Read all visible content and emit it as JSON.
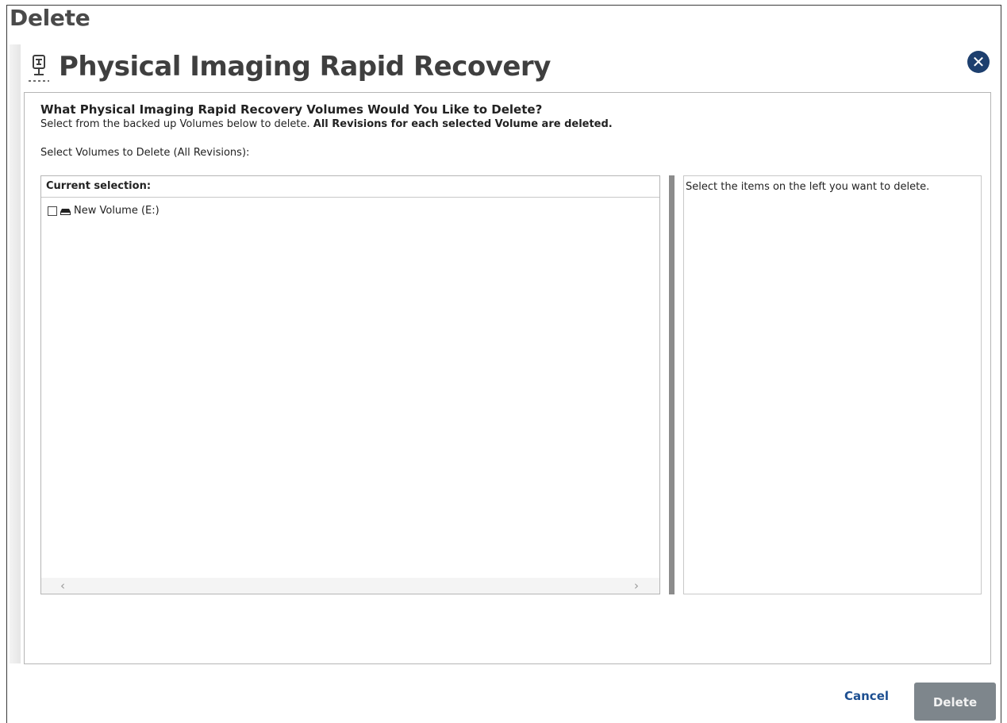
{
  "page": {
    "title": "Delete"
  },
  "dialog": {
    "title": "Physical Imaging Rapid Recovery",
    "icon": "physical-imaging-icon",
    "close_icon": "close-icon",
    "question": "What Physical Imaging Rapid Recovery Volumes Would You Like to Delete?",
    "instruction_plain": "Select from the backed up Volumes below to delete. ",
    "instruction_bold": "All Revisions for each selected Volume are deleted.",
    "select_label": "Select Volumes to Delete (All Revisions):"
  },
  "tree": {
    "header": "Current selection:",
    "items": [
      {
        "label": "New Volume (E:)",
        "checked": false,
        "icon": "drive-icon"
      }
    ],
    "scroll_left_glyph": "‹",
    "scroll_right_glyph": "›"
  },
  "details": {
    "text": "Select the items on the left you want to delete."
  },
  "footer": {
    "cancel_label": "Cancel",
    "delete_label": "Delete"
  },
  "colors": {
    "title_text": "#3f3f3f",
    "close_button": "#1d3f6e",
    "cancel_link": "#1d4f91",
    "delete_button_bg": "#7e868c",
    "splitter": "#8c8c8c"
  }
}
